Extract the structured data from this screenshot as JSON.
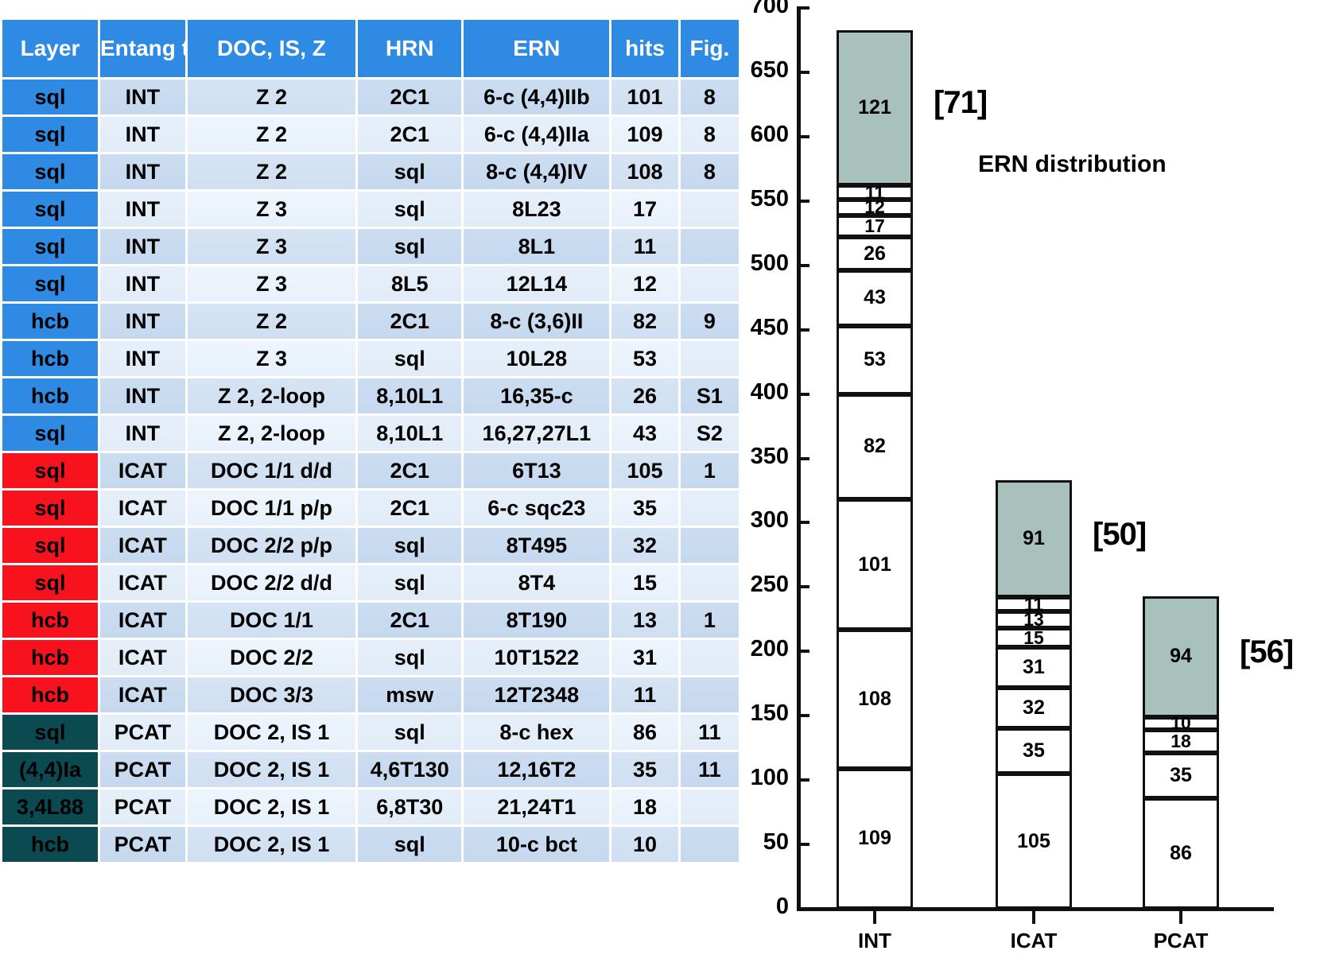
{
  "table": {
    "columns": [
      "Layer",
      "Entang type",
      "DOC, IS, Z",
      "HRN",
      "ERN",
      "hits",
      "Fig."
    ],
    "rows": [
      {
        "layer": "sql",
        "type": "INT",
        "doc": "Z 2",
        "hrn": "2C1",
        "ern": "6-c  (4,4)IIb",
        "hits": "101",
        "fig": "8"
      },
      {
        "layer": "sql",
        "type": "INT",
        "doc": "Z 2",
        "hrn": "2C1",
        "ern": "6-c  (4,4)IIa",
        "hits": "109",
        "fig": "8"
      },
      {
        "layer": "sql",
        "type": "INT",
        "doc": "Z 2",
        "hrn": "sql",
        "ern": "8-c  (4,4)IV",
        "hits": "108",
        "fig": "8"
      },
      {
        "layer": "sql",
        "type": "INT",
        "doc": "Z 3",
        "hrn": "sql",
        "ern": "8L23",
        "hits": "17",
        "fig": ""
      },
      {
        "layer": "sql",
        "type": "INT",
        "doc": "Z 3",
        "hrn": "sql",
        "ern": "8L1",
        "hits": "11",
        "fig": ""
      },
      {
        "layer": "sql",
        "type": "INT",
        "doc": "Z 3",
        "hrn": "8L5",
        "ern": "12L14",
        "hits": "12",
        "fig": ""
      },
      {
        "layer": "hcb",
        "type": "INT",
        "doc": "Z 2",
        "hrn": "2C1",
        "ern": "8-c  (3,6)II",
        "hits": "82",
        "fig": "9"
      },
      {
        "layer": "hcb",
        "type": "INT",
        "doc": "Z 3",
        "hrn": "sql",
        "ern": "10L28",
        "hits": "53",
        "fig": ""
      },
      {
        "layer": "hcb",
        "type": "INT",
        "doc": "Z 2, 2-loop",
        "hrn": "8,10L1",
        "ern": "16,35-c",
        "hits": "26",
        "fig": "S1"
      },
      {
        "layer": "sql",
        "type": "INT",
        "doc": "Z 2, 2-loop",
        "hrn": "8,10L1",
        "ern": "16,27,27L1",
        "hits": "43",
        "fig": "S2"
      },
      {
        "layer": "sql",
        "type": "ICAT",
        "doc": "DOC 1/1 d/d",
        "hrn": "2C1",
        "ern": "6T13",
        "hits": "105",
        "fig": "1"
      },
      {
        "layer": "sql",
        "type": "ICAT",
        "doc": "DOC 1/1 p/p",
        "hrn": "2C1",
        "ern": "6-c sqc23",
        "hits": "35",
        "fig": ""
      },
      {
        "layer": "sql",
        "type": "ICAT",
        "doc": "DOC 2/2 p/p",
        "hrn": "sql",
        "ern": "8T495",
        "hits": "32",
        "fig": ""
      },
      {
        "layer": "sql",
        "type": "ICAT",
        "doc": "DOC 2/2 d/d",
        "hrn": "sql",
        "ern": "8T4",
        "hits": "15",
        "fig": ""
      },
      {
        "layer": "hcb",
        "type": "ICAT",
        "doc": "DOC 1/1",
        "hrn": "2C1",
        "ern": "8T190",
        "hits": "13",
        "fig": "1"
      },
      {
        "layer": "hcb",
        "type": "ICAT",
        "doc": "DOC 2/2",
        "hrn": "sql",
        "ern": "10T1522",
        "hits": "31",
        "fig": ""
      },
      {
        "layer": "hcb",
        "type": "ICAT",
        "doc": "DOC 3/3",
        "hrn": "msw",
        "ern": "12T2348",
        "hits": "11",
        "fig": ""
      },
      {
        "layer": "sql",
        "type": "PCAT",
        "doc": "DOC 2, IS 1",
        "hrn": "sql",
        "ern": "8-c hex",
        "hits": "86",
        "fig": "11"
      },
      {
        "layer": "(4,4)Ia",
        "type": "PCAT",
        "doc": "DOC 2, IS 1",
        "hrn": "4,6T130",
        "ern": "12,16T2",
        "hits": "35",
        "fig": "11"
      },
      {
        "layer": "3,4L88",
        "type": "PCAT",
        "doc": "DOC 2, IS 1",
        "hrn": "6,8T30",
        "ern": "21,24T1",
        "hits": "18",
        "fig": ""
      },
      {
        "layer": "hcb",
        "type": "PCAT",
        "doc": "DOC 2, IS 1",
        "hrn": "sql",
        "ern": "10-c bct",
        "hits": "10",
        "fig": ""
      }
    ],
    "colors": {
      "header_blue": "#2f8ae4",
      "int_blue": "#2f8ae4",
      "icat_red": "#f8121e",
      "pcat_teal": "#0b4a50"
    }
  },
  "chart_data": {
    "type": "bar",
    "subtype": "stacked",
    "title": "ERN distribution",
    "xlabel": "",
    "ylabel": "",
    "ylim": [
      0,
      700
    ],
    "yticks": [
      0,
      50,
      100,
      150,
      200,
      250,
      300,
      350,
      400,
      450,
      500,
      550,
      600,
      650,
      700
    ],
    "grid": false,
    "legend": "none",
    "categories": [
      "INT",
      "ICAT",
      "PCAT"
    ],
    "segment_colors": {
      "normal": "#ffffff",
      "top_remainder": "#a9c1bd",
      "border": "#111111"
    },
    "bars": [
      {
        "category": "INT",
        "total": 683,
        "annotation": "[71]",
        "segments": [
          {
            "value": 109,
            "label": "109",
            "color": "#ffffff"
          },
          {
            "value": 108,
            "label": "108",
            "color": "#ffffff"
          },
          {
            "value": 101,
            "label": "101",
            "color": "#ffffff"
          },
          {
            "value": 82,
            "label": "82",
            "color": "#ffffff"
          },
          {
            "value": 53,
            "label": "53",
            "color": "#ffffff"
          },
          {
            "value": 43,
            "label": "43",
            "color": "#ffffff"
          },
          {
            "value": 26,
            "label": "26",
            "color": "#ffffff"
          },
          {
            "value": 17,
            "label": "17",
            "color": "#ffffff"
          },
          {
            "value": 12,
            "label": "12",
            "color": "#ffffff"
          },
          {
            "value": 11,
            "label": "11",
            "color": "#ffffff"
          },
          {
            "value": 121,
            "label": "121",
            "color": "#a9c1bd"
          }
        ]
      },
      {
        "category": "ICAT",
        "total": 333,
        "annotation": "[50]",
        "segments": [
          {
            "value": 105,
            "label": "105",
            "color": "#ffffff"
          },
          {
            "value": 35,
            "label": "35",
            "color": "#ffffff"
          },
          {
            "value": 32,
            "label": "32",
            "color": "#ffffff"
          },
          {
            "value": 31,
            "label": "31",
            "color": "#ffffff"
          },
          {
            "value": 15,
            "label": "15",
            "color": "#ffffff"
          },
          {
            "value": 13,
            "label": "13",
            "color": "#ffffff"
          },
          {
            "value": 11,
            "label": "11",
            "color": "#ffffff"
          },
          {
            "value": 91,
            "label": "91",
            "color": "#a9c1bd"
          }
        ]
      },
      {
        "category": "PCAT",
        "total": 243,
        "annotation": "[56]",
        "segments": [
          {
            "value": 86,
            "label": "86",
            "color": "#ffffff"
          },
          {
            "value": 35,
            "label": "35",
            "color": "#ffffff"
          },
          {
            "value": 18,
            "label": "18",
            "color": "#ffffff"
          },
          {
            "value": 10,
            "label": "10",
            "color": "#ffffff"
          },
          {
            "value": 94,
            "label": "94",
            "color": "#a9c1bd"
          }
        ]
      }
    ]
  }
}
